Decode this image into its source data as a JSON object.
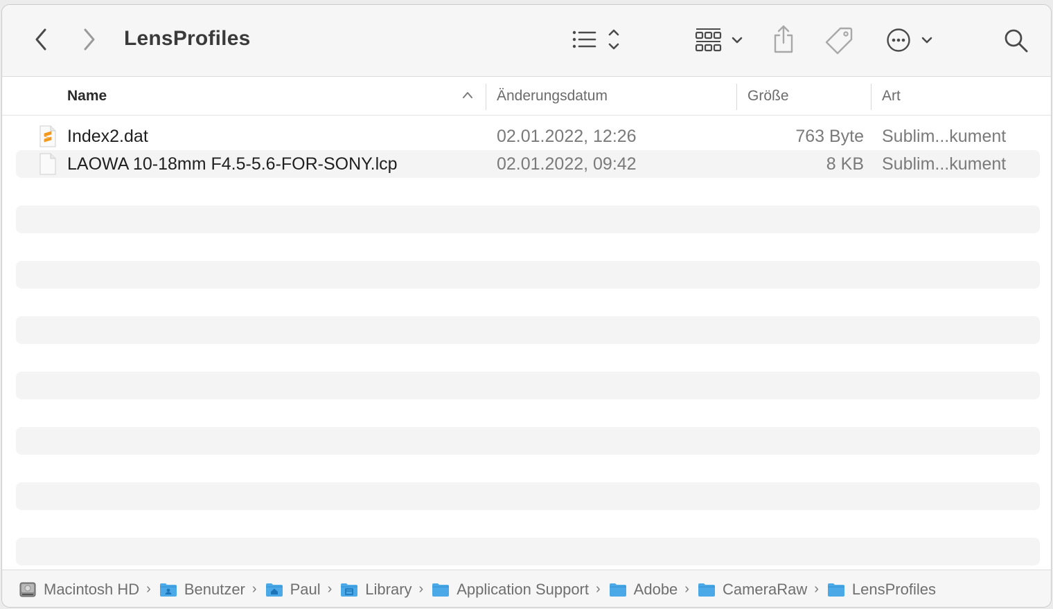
{
  "window": {
    "title": "LensProfiles"
  },
  "columns": {
    "name": "Name",
    "date": "Änderungsdatum",
    "size": "Größe",
    "kind": "Art"
  },
  "files": [
    {
      "name": "Index2.dat",
      "date": "02.01.2022, 12:26",
      "size": "763 Byte",
      "kind": "Sublim...kument",
      "icon": "sublime-document-icon"
    },
    {
      "name": "LAOWA 10-18mm F4.5-5.6-FOR-SONY.lcp",
      "date": "02.01.2022, 09:42",
      "size": "8 KB",
      "kind": "Sublim...kument",
      "icon": "blank-document-icon"
    }
  ],
  "pathbar": [
    {
      "label": "Macintosh HD",
      "icon": "hard-drive-icon"
    },
    {
      "label": "Benutzer",
      "icon": "users-folder-icon"
    },
    {
      "label": "Paul",
      "icon": "home-folder-icon"
    },
    {
      "label": "Library",
      "icon": "library-folder-icon"
    },
    {
      "label": "Application Support",
      "icon": "folder-icon"
    },
    {
      "label": "Adobe",
      "icon": "folder-icon"
    },
    {
      "label": "CameraRaw",
      "icon": "folder-icon"
    },
    {
      "label": "LensProfiles",
      "icon": "folder-icon"
    }
  ],
  "colors": {
    "folder": "#4ba9e8",
    "stripe": "#f4f4f4",
    "sublime": "#f29a1d"
  }
}
